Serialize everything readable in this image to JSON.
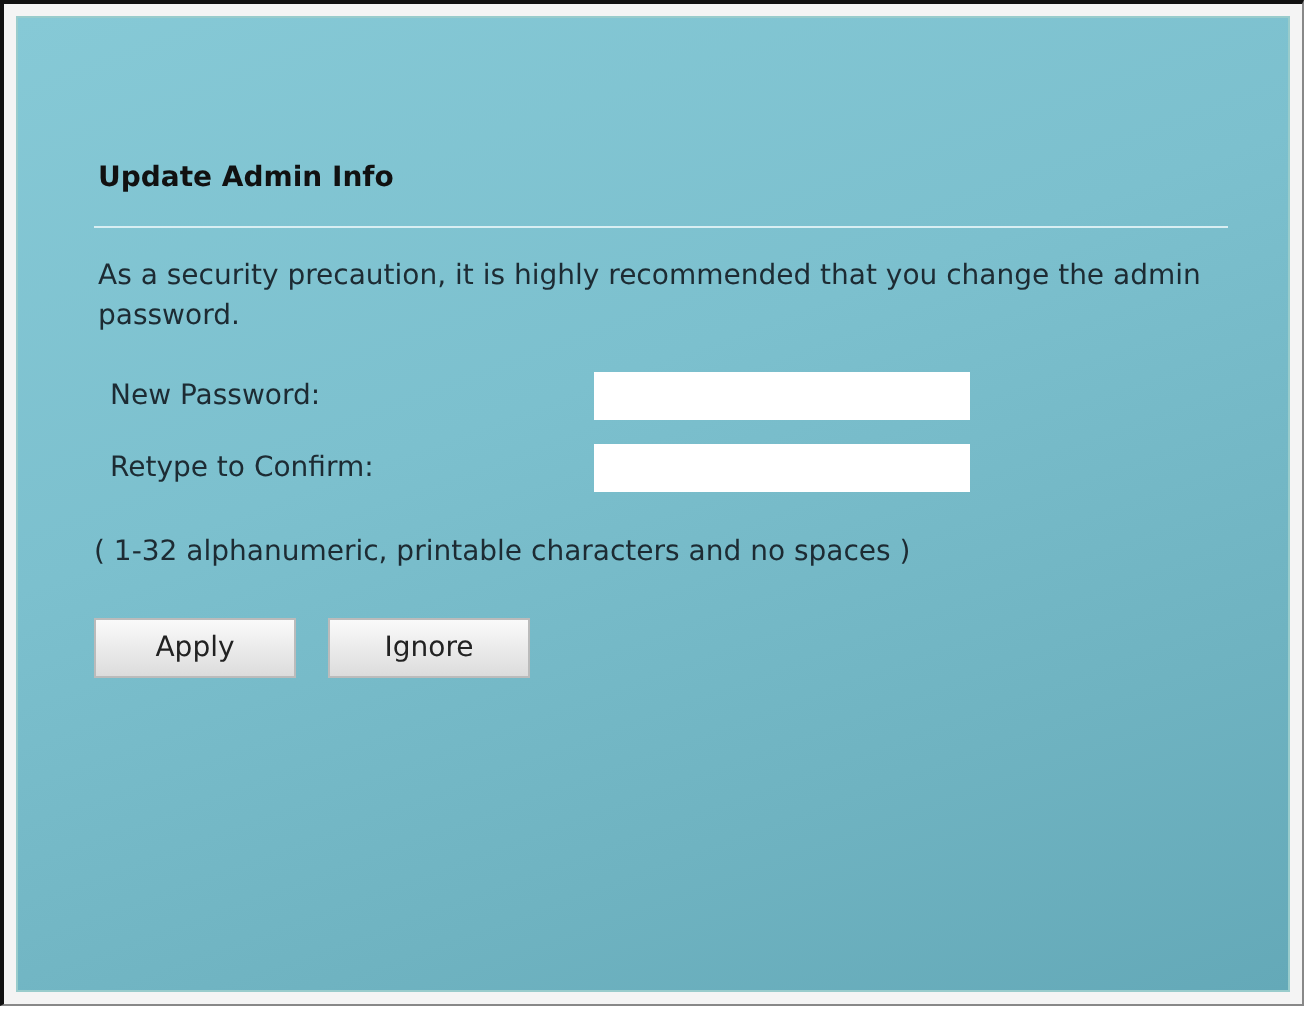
{
  "title": "Update Admin Info",
  "message": "As a security precaution, it is highly recommended that you change the admin password.",
  "fields": [
    {
      "label": "New Password:"
    },
    {
      "label": "Retype to Confirm:"
    }
  ],
  "hint": "( 1-32 alphanumeric, printable characters and no spaces )",
  "buttons": [
    "Apply",
    "Ignore"
  ]
}
